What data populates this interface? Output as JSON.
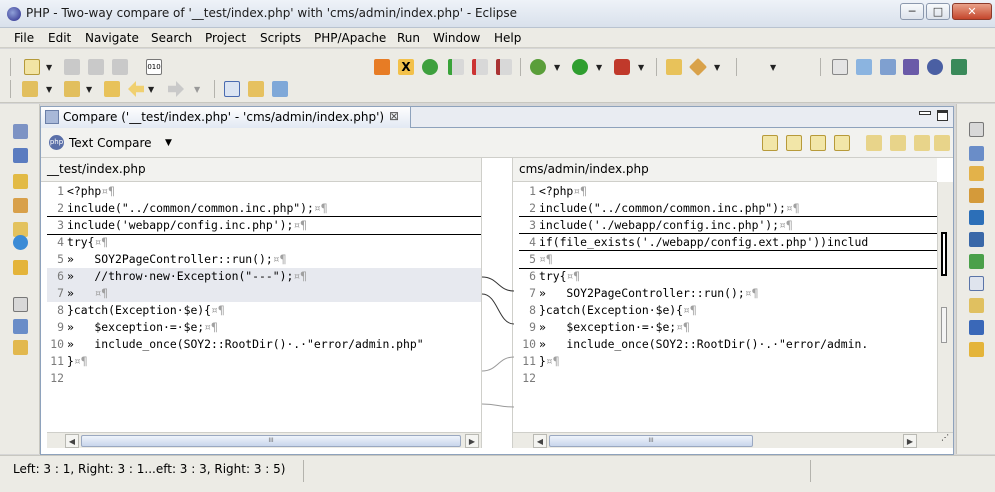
{
  "window": {
    "title": "PHP - Two-way compare of '__test/index.php' with 'cms/admin/index.php' - Eclipse",
    "minimize_label": "─",
    "maximize_label": "□",
    "close_label": "✕"
  },
  "menu": [
    "File",
    "Edit",
    "Navigate",
    "Search",
    "Project",
    "Scripts",
    "PHP/Apache",
    "Run",
    "Window",
    "Help"
  ],
  "editor": {
    "tab_label": "Compare ('__test/index.php' - 'cms/admin/index.php')",
    "tab_close": "⊠",
    "view_label": "Text Compare",
    "left": {
      "header": "__test/index.php",
      "lines": [
        {
          "n": "1",
          "code": "<?php",
          "mark": "¤¶"
        },
        {
          "n": "2",
          "code": "include(\"../common/common.inc.php\");",
          "mark": "¤¶"
        },
        {
          "n": "3",
          "code": "include('webapp/config.inc.php');",
          "mark": "¤¶"
        },
        {
          "n": "4",
          "code": "try{",
          "mark": "¤¶"
        },
        {
          "n": "5",
          "code": "»   SOY2PageController::run();",
          "mark": "¤¶"
        },
        {
          "n": "6",
          "code": "»   //throw·new·Exception(\"---\");",
          "mark": "¤¶"
        },
        {
          "n": "7",
          "code": "»   ",
          "mark": "¤¶"
        },
        {
          "n": "8",
          "code": "}catch(Exception·$e){",
          "mark": "¤¶"
        },
        {
          "n": "9",
          "code": "»   $exception·=·$e;",
          "mark": "¤¶"
        },
        {
          "n": "10",
          "code": "»   include_once(SOY2::RootDir()·.·\"error/admin.php\"",
          "mark": ""
        },
        {
          "n": "11",
          "code": "}",
          "mark": "¤¶"
        },
        {
          "n": "12",
          "code": "",
          "mark": ""
        }
      ]
    },
    "right": {
      "header": "cms/admin/index.php",
      "lines": [
        {
          "n": "1",
          "code": "<?php",
          "mark": "¤¶"
        },
        {
          "n": "2",
          "code": "include(\"../common/common.inc.php\");",
          "mark": "¤¶"
        },
        {
          "n": "3",
          "code": "include('./webapp/config.inc.php');",
          "mark": "¤¶"
        },
        {
          "n": "4",
          "code": "if(file_exists('./webapp/config.ext.php'))includ",
          "mark": ""
        },
        {
          "n": "5",
          "code": "",
          "mark": "¤¶"
        },
        {
          "n": "6",
          "code": "try{",
          "mark": "¤¶"
        },
        {
          "n": "7",
          "code": "»   SOY2PageController::run();",
          "mark": "¤¶"
        },
        {
          "n": "8",
          "code": "}catch(Exception·$e){",
          "mark": "¤¶"
        },
        {
          "n": "9",
          "code": "»   $exception·=·$e;",
          "mark": "¤¶"
        },
        {
          "n": "10",
          "code": "»   include_once(SOY2::RootDir()·.·\"error/admin.",
          "mark": ""
        },
        {
          "n": "11",
          "code": "}",
          "mark": "¤¶"
        },
        {
          "n": "12",
          "code": "",
          "mark": ""
        }
      ]
    }
  },
  "status": {
    "text": "Left: 3 : 1, Right: 3 : 1...eft: 3 : 3, Right: 3 : 5)"
  }
}
